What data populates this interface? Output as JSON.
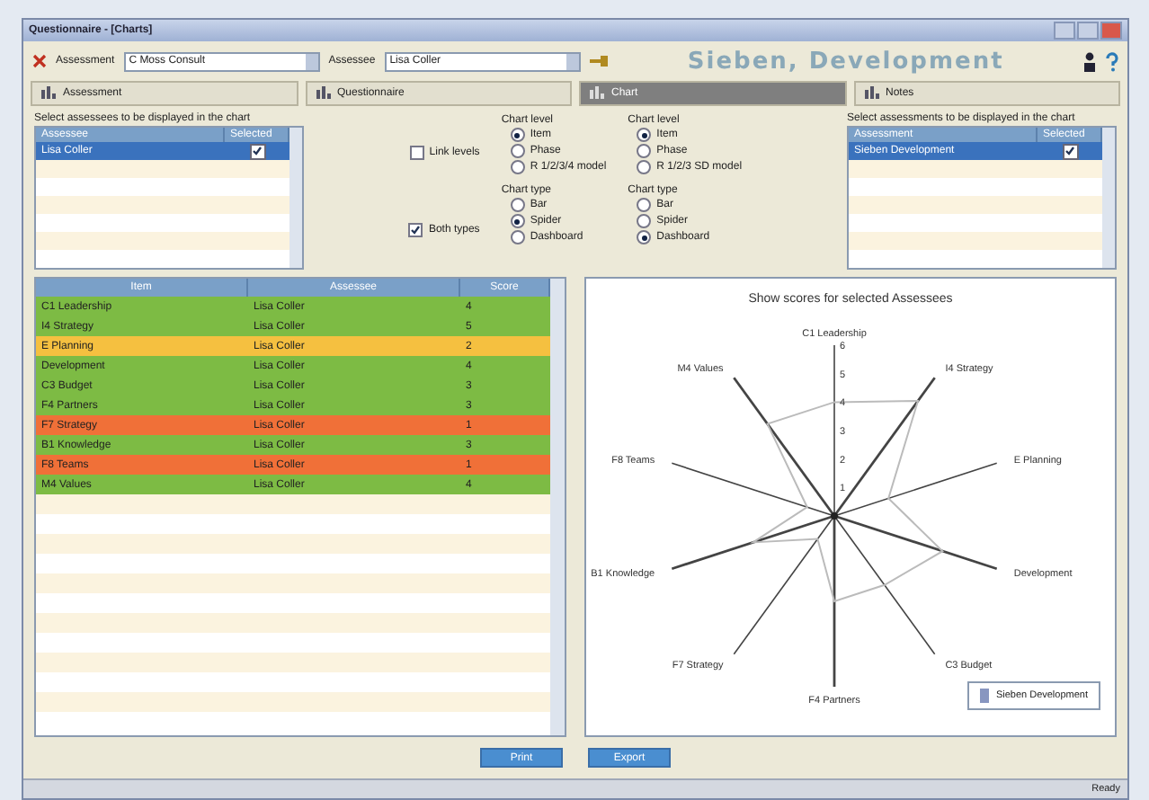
{
  "window": {
    "title": "Questionnaire - [Charts]"
  },
  "toolbar": {
    "assessment_label": "Assessment",
    "assessment_value": "C Moss Consult",
    "assessee_label": "Assessee",
    "assessee_value": "Lisa Coller",
    "heading": "Sieben, Development"
  },
  "tabs": [
    {
      "label": "Assessment",
      "selected": false
    },
    {
      "label": "Questionnaire",
      "selected": false
    },
    {
      "label": "Chart",
      "selected": true
    },
    {
      "label": "Notes",
      "selected": false
    }
  ],
  "assessee_list": {
    "caption": "Select assessees to be displayed in the chart",
    "columns": [
      "Assessee",
      "Selected"
    ],
    "rows": [
      {
        "name": "Lisa Coller",
        "checked": true,
        "selected": true
      }
    ]
  },
  "link_levels": {
    "label": "Link levels",
    "checked": false
  },
  "both_types": {
    "label": "Both types",
    "checked": true
  },
  "option_groups": [
    {
      "level_title": "Chart level",
      "levels": [
        {
          "label": "Item",
          "selected": true
        },
        {
          "label": "Phase",
          "selected": false
        },
        {
          "label": "R 1/2/3/4 model",
          "selected": false
        }
      ],
      "type_title": "Chart type",
      "types": [
        {
          "label": "Bar",
          "selected": false
        },
        {
          "label": "Spider",
          "selected": true
        },
        {
          "label": "Dashboard",
          "selected": false
        }
      ]
    },
    {
      "level_title": "Chart level",
      "levels": [
        {
          "label": "Item",
          "selected": true
        },
        {
          "label": "Phase",
          "selected": false
        },
        {
          "label": "R 1/2/3 SD model",
          "selected": false
        }
      ],
      "type_title": "Chart type",
      "types": [
        {
          "label": "Bar",
          "selected": false
        },
        {
          "label": "Spider",
          "selected": false
        },
        {
          "label": "Dashboard",
          "selected": true
        }
      ]
    }
  ],
  "assessment_list": {
    "caption": "Select assessments to be displayed in the chart",
    "columns": [
      "Assessment",
      "Selected"
    ],
    "rows": [
      {
        "name": "Sieben Development",
        "checked": true,
        "selected": true
      }
    ]
  },
  "score_table": {
    "columns": [
      "Item",
      "Assessee",
      "Score"
    ],
    "rows": [
      {
        "item": "C1 Leadership",
        "assessee": "Lisa Coller",
        "score": "4",
        "color": "#7dbb44"
      },
      {
        "item": "I4 Strategy",
        "assessee": "Lisa Coller",
        "score": "5",
        "color": "#7dbb44"
      },
      {
        "item": "E Planning",
        "assessee": "Lisa Coller",
        "score": "2",
        "color": "#f5c040"
      },
      {
        "item": "Development",
        "assessee": "Lisa Coller",
        "score": "4",
        "color": "#7dbb44"
      },
      {
        "item": "C3 Budget",
        "assessee": "Lisa Coller",
        "score": "3",
        "color": "#7dbb44"
      },
      {
        "item": "F4 Partners",
        "assessee": "Lisa Coller",
        "score": "3",
        "color": "#7dbb44"
      },
      {
        "item": "F7 Strategy",
        "assessee": "Lisa Coller",
        "score": "1",
        "color": "#f07038"
      },
      {
        "item": "B1 Knowledge",
        "assessee": "Lisa Coller",
        "score": "3",
        "color": "#7dbb44"
      },
      {
        "item": "F8 Teams",
        "assessee": "Lisa Coller",
        "score": "1",
        "color": "#f07038"
      },
      {
        "item": "M4 Values",
        "assessee": "Lisa Coller",
        "score": "4",
        "color": "#7dbb44"
      }
    ]
  },
  "spider_chart": {
    "title": "Show scores for selected Assessees",
    "axis_labels": [
      "C1 Leadership",
      "M4 Values",
      "I4 Strategy",
      "F8 Teams",
      "E Planning",
      "B1 Knowledge",
      "Development",
      "F7 Strategy",
      "C3 Budget",
      "F4 Partners"
    ],
    "axis_ticks": [
      "6",
      "5",
      "4",
      "3",
      "2",
      "1"
    ],
    "legend": "Sieben Development"
  },
  "buttons": [
    "Print",
    "Export"
  ],
  "status_bar": {
    "text": "Ready"
  }
}
